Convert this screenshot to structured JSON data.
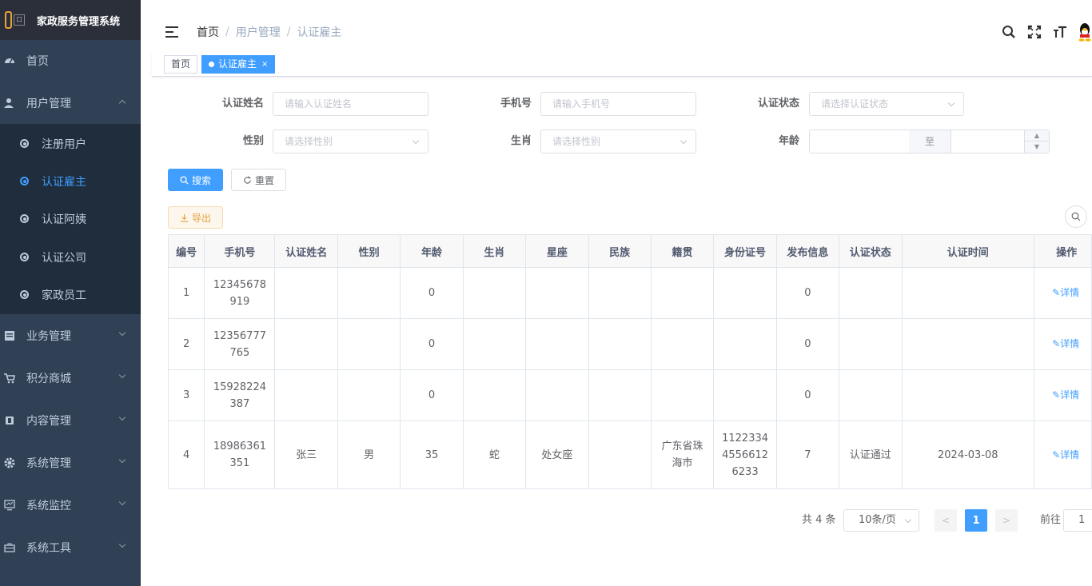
{
  "app": {
    "title": "家政服务管理系统"
  },
  "sidebar": {
    "items": [
      {
        "label": "首页",
        "icon": "dashboard-icon"
      },
      {
        "label": "用户管理",
        "icon": "user-icon",
        "expanded": true,
        "children": [
          {
            "label": "注册用户"
          },
          {
            "label": "认证雇主",
            "active": true
          },
          {
            "label": "认证阿姨"
          },
          {
            "label": "认证公司"
          },
          {
            "label": "家政员工"
          }
        ]
      },
      {
        "label": "业务管理",
        "icon": "document-icon"
      },
      {
        "label": "积分商城",
        "icon": "cart-icon"
      },
      {
        "label": "内容管理",
        "icon": "content-icon"
      },
      {
        "label": "系统管理",
        "icon": "gear-icon"
      },
      {
        "label": "系统监控",
        "icon": "monitor-icon"
      },
      {
        "label": "系统工具",
        "icon": "toolbox-icon"
      }
    ]
  },
  "breadcrumb": [
    "首页",
    "用户管理",
    "认证雇主"
  ],
  "tags": [
    {
      "label": "首页"
    },
    {
      "label": "认证雇主",
      "active": true,
      "close": "×"
    }
  ],
  "search": {
    "name_label": "认证姓名",
    "name_placeholder": "请输入认证姓名",
    "phone_label": "手机号",
    "phone_placeholder": "请输入手机号",
    "status_label": "认证状态",
    "status_placeholder": "请选择认证状态",
    "gender_label": "性别",
    "gender_placeholder": "请选择性别",
    "zodiac_label": "生肖",
    "zodiac_placeholder": "请选择性别",
    "age_label": "年龄",
    "age_sep": "至",
    "search_btn": "搜索",
    "reset_btn": "重置",
    "export_btn": "导出"
  },
  "table": {
    "columns": [
      "编号",
      "手机号",
      "认证姓名",
      "性别",
      "年龄",
      "生肖",
      "星座",
      "民族",
      "籍贯",
      "身份证号",
      "发布信息",
      "认证状态",
      "认证时间",
      "操作"
    ],
    "rows": [
      [
        "1",
        "12345678919",
        "",
        "",
        "0",
        "",
        "",
        "",
        "",
        "",
        "0",
        "",
        "",
        "详情"
      ],
      [
        "2",
        "12356777765",
        "",
        "",
        "0",
        "",
        "",
        "",
        "",
        "",
        "0",
        "",
        "",
        "详情"
      ],
      [
        "3",
        "15928224387",
        "",
        "",
        "0",
        "",
        "",
        "",
        "",
        "",
        "0",
        "",
        "",
        "详情"
      ],
      [
        "4",
        "18986361351",
        "张三",
        "男",
        "35",
        "蛇",
        "处女座",
        "",
        "广东省珠海市",
        "112233445566126233",
        "7",
        "认证通过",
        "2024-03-08",
        "详情"
      ]
    ]
  },
  "pagination": {
    "total": "共 4 条",
    "page_size": "10条/页",
    "prev": "<",
    "current": "1",
    "next": ">",
    "goto": "前往",
    "goto_value": "1"
  },
  "colors": {
    "accent": "#409eff",
    "sidebar": "#304156",
    "submenu": "#1f2d3d",
    "warning": "#e6a23c"
  }
}
